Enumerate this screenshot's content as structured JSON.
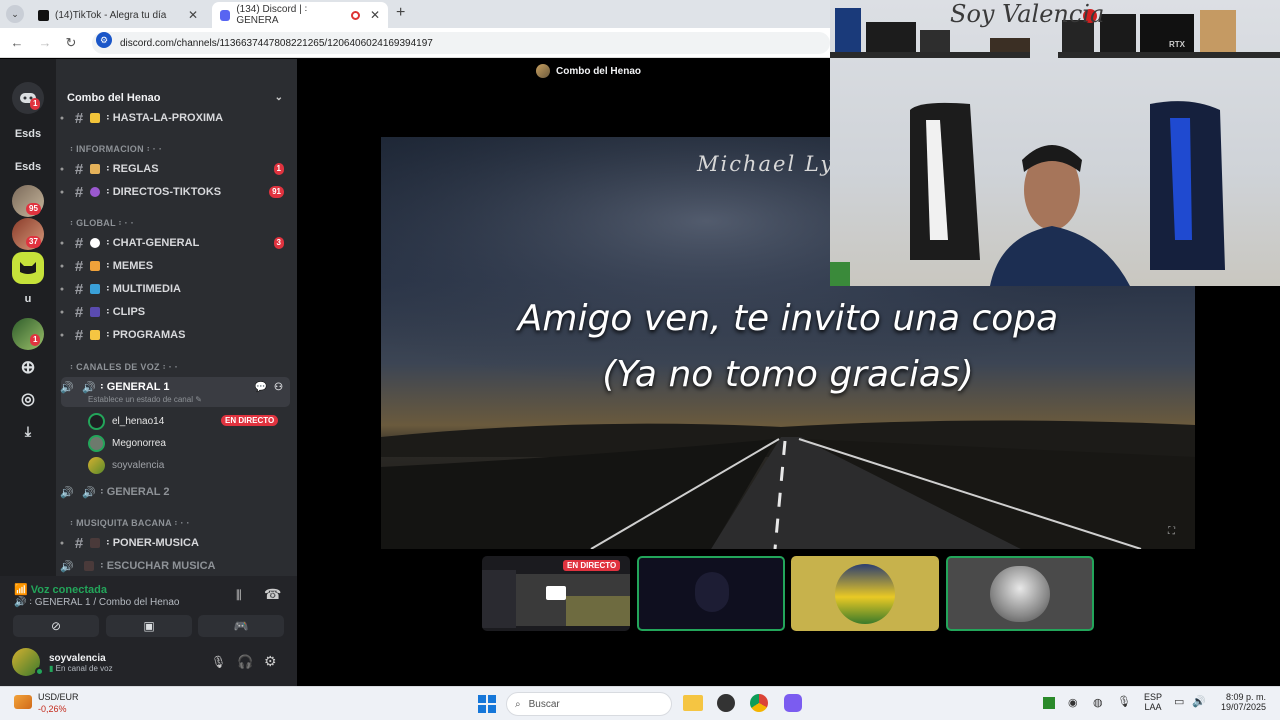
{
  "browser": {
    "tabs": [
      {
        "label": "(14)TikTok - Alegra tu día",
        "active": false
      },
      {
        "label": "(134) Discord | ꞉ GENERA",
        "active": true
      }
    ],
    "url": "discord.com/channels/1136637447808221265/1206406024169394197"
  },
  "discord": {
    "guild_name": "Combo del Henao",
    "stage_title": "Combo del Henao",
    "servers": [
      {
        "label": "",
        "badge": "1"
      },
      {
        "label": "Esds",
        "badge": ""
      },
      {
        "label": "Esds",
        "badge": ""
      },
      {
        "label": "",
        "badge": "95"
      },
      {
        "label": "",
        "badge": "37"
      },
      {
        "label": "",
        "badge": ""
      },
      {
        "label": "u",
        "badge": ""
      },
      {
        "label": "",
        "badge": "1"
      }
    ],
    "channels": [
      {
        "name": "꞉ HASTA-LA-PROXIMA",
        "type": "text",
        "count": ""
      },
      {
        "category": "꞉ INFORMACION ꞉ · ·"
      },
      {
        "name": "꞉ REGLAS",
        "type": "text",
        "count": "1"
      },
      {
        "name": "꞉ DIRECTOS-TIKTOKS",
        "type": "text",
        "count": "91"
      },
      {
        "category": "꞉ GLOBAL ꞉ · ·"
      },
      {
        "name": "꞉ CHAT-GENERAL",
        "type": "text",
        "count": "3"
      },
      {
        "name": "꞉ MEMES",
        "type": "text",
        "count": ""
      },
      {
        "name": "꞉ MULTIMEDIA",
        "type": "text",
        "count": ""
      },
      {
        "name": "꞉ CLIPS",
        "type": "text",
        "count": ""
      },
      {
        "name": "꞉ PROGRAMAS",
        "type": "text",
        "count": ""
      },
      {
        "category": "꞉ CANALES DE VOZ ꞉ · ·"
      },
      {
        "name": "꞉ GENERAL 1",
        "type": "voice",
        "status": "Establece un estado de canal"
      },
      {
        "name": "꞉ GENERAL 2",
        "type": "voice"
      },
      {
        "category": "꞉ MUSIQUITA BACANA ꞉ · ·"
      },
      {
        "name": "꞉ PONER-MUSICA",
        "type": "text",
        "count": ""
      },
      {
        "name": "꞉ ESCUCHAR MUSICA",
        "type": "voice"
      }
    ],
    "voice_users": [
      {
        "name": "el_henao14",
        "live": "EN DIRECTO"
      },
      {
        "name": "Megonorrea",
        "live": ""
      },
      {
        "name": "soyvalencia",
        "live": ""
      }
    ],
    "voice_panel": {
      "status": "Voz conectada",
      "channel": "꞉ GENERAL 1 / Combo del Henao"
    },
    "user": {
      "name": "soyvalencia",
      "status": "En canal de voz"
    },
    "stream": {
      "watermark": "Michael Ly",
      "lyric_line1": "Amigo ven, te invito una copa",
      "lyric_line2": "(Ya no tomo gracias)",
      "thumb_live": "EN DIRECTO"
    }
  },
  "webcam": {
    "sign": "Soy Valencia",
    "gpu_label": "RTX"
  },
  "taskbar": {
    "stock_name": "USD/EUR",
    "stock_change": "-0,26%",
    "search_placeholder": "Buscar",
    "lang1": "ESP",
    "lang2": "LAA",
    "time": "8:09 p. m.",
    "date": "19/07/2025"
  },
  "colors": {
    "accent_red": "#e0333f",
    "voice_green": "#23a55a",
    "discord_bg": "#2b2d31"
  }
}
